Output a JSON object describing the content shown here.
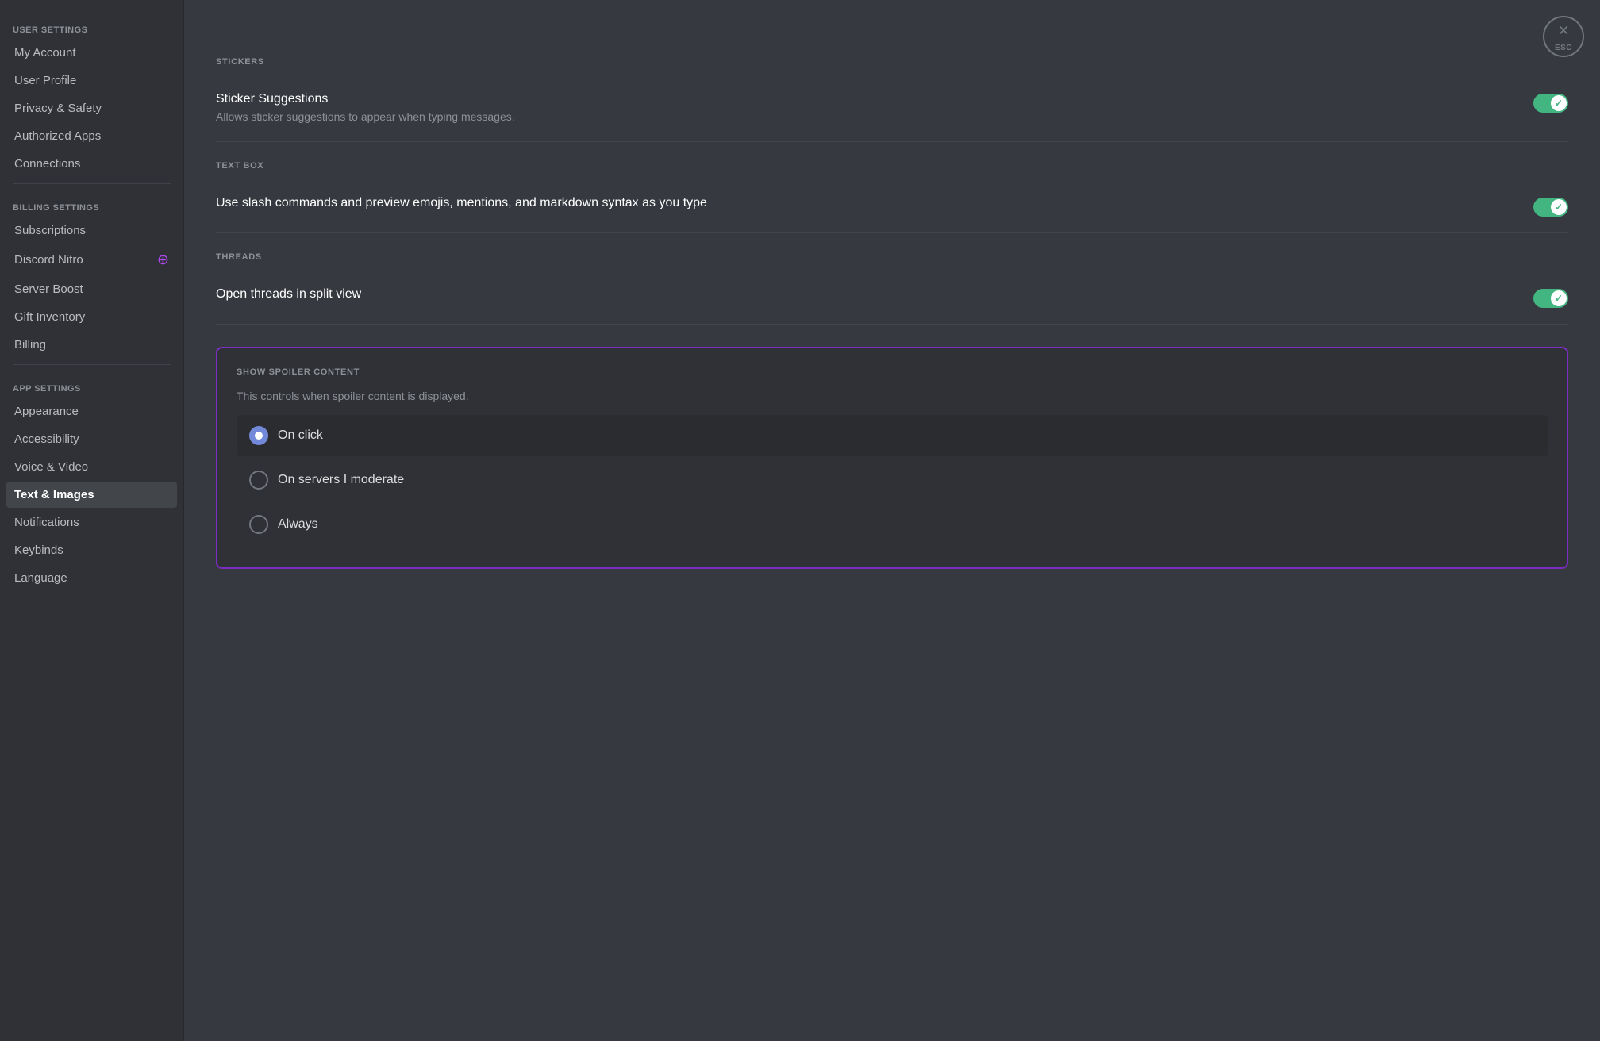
{
  "sidebar": {
    "user_settings_label": "USER SETTINGS",
    "items_user": [
      {
        "id": "my-account",
        "label": "My Account",
        "active": false
      },
      {
        "id": "user-profile",
        "label": "User Profile",
        "active": false
      },
      {
        "id": "privacy-safety",
        "label": "Privacy & Safety",
        "active": false
      },
      {
        "id": "authorized-apps",
        "label": "Authorized Apps",
        "active": false
      },
      {
        "id": "connections",
        "label": "Connections",
        "active": false
      }
    ],
    "billing_settings_label": "BILLING SETTINGS",
    "items_billing": [
      {
        "id": "subscriptions",
        "label": "Subscriptions",
        "active": false
      },
      {
        "id": "discord-nitro",
        "label": "Discord Nitro",
        "active": false,
        "has_icon": true
      },
      {
        "id": "server-boost",
        "label": "Server Boost",
        "active": false
      },
      {
        "id": "gift-inventory",
        "label": "Gift Inventory",
        "active": false
      },
      {
        "id": "billing",
        "label": "Billing",
        "active": false
      }
    ],
    "app_settings_label": "APP SETTINGS",
    "items_app": [
      {
        "id": "appearance",
        "label": "Appearance",
        "active": false
      },
      {
        "id": "accessibility",
        "label": "Accessibility",
        "active": false
      },
      {
        "id": "voice-video",
        "label": "Voice & Video",
        "active": false
      },
      {
        "id": "text-images",
        "label": "Text & Images",
        "active": true
      },
      {
        "id": "notifications",
        "label": "Notifications",
        "active": false
      },
      {
        "id": "keybinds",
        "label": "Keybinds",
        "active": false
      },
      {
        "id": "language",
        "label": "Language",
        "active": false
      }
    ]
  },
  "close_button": {
    "label": "ESC",
    "icon": "×"
  },
  "sections": {
    "stickers": {
      "heading": "STICKERS",
      "title": "Sticker Suggestions",
      "desc": "Allows sticker suggestions to appear when typing messages.",
      "enabled": true
    },
    "text_box": {
      "heading": "TEXT BOX",
      "title": "Use slash commands and preview emojis, mentions, and markdown syntax as you type",
      "enabled": true
    },
    "threads": {
      "heading": "THREADS",
      "title": "Open threads in split view",
      "enabled": true
    },
    "spoiler": {
      "heading": "SHOW SPOILER CONTENT",
      "desc": "This controls when spoiler content is displayed.",
      "options": [
        {
          "id": "on-click",
          "label": "On click",
          "selected": true
        },
        {
          "id": "on-servers-moderate",
          "label": "On servers I moderate",
          "selected": false
        },
        {
          "id": "always",
          "label": "Always",
          "selected": false
        }
      ]
    }
  }
}
